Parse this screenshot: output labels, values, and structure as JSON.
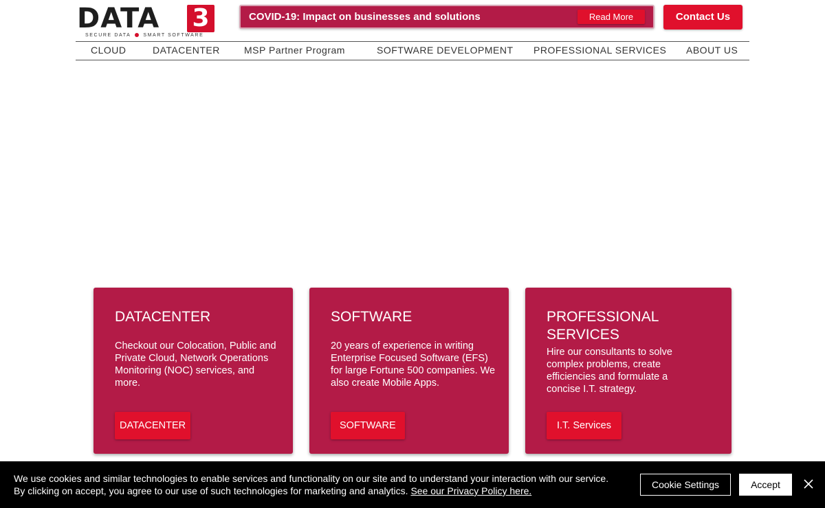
{
  "header": {
    "logo": {
      "word": "DATA",
      "digit": "3",
      "tagline_left": "SECURE DATA",
      "tagline_right": "SMART SOFTWARE"
    },
    "banner": {
      "text": "COVID-19: Impact on businesses and solutions",
      "read_more": "Read More"
    },
    "contact_label": "Contact Us"
  },
  "nav": {
    "items": [
      {
        "label": "CLOUD"
      },
      {
        "label": "DATACENTER"
      },
      {
        "label": "MSP Partner Program"
      },
      {
        "label": "SOFTWARE DEVELOPMENT"
      },
      {
        "label": "PROFESSIONAL SERVICES"
      },
      {
        "label": "ABOUT US"
      }
    ]
  },
  "cards": [
    {
      "title": "DATACENTER",
      "description": "Checkout our Colocation, Public and Private Cloud, Network Operations Monitoring (NOC) services, and more.",
      "button": "DATACENTER"
    },
    {
      "title": "SOFTWARE",
      "description": "20 years of experience in writing Enterprise Focused Software (EFS) for large Fortune 500 companies. We also create Mobile Apps.",
      "button": "SOFTWARE"
    },
    {
      "title": "PROFESSIONAL SERVICES",
      "description": "Hire our consultants to solve complex problems,  create efficiencies and formulate a concise I.T. strategy.",
      "button": "I.T. Services"
    }
  ],
  "cookie": {
    "line1": "We use cookies and similar technologies to enable services and functionality on our site and to understand your interaction with our service.",
    "line2": "By clicking on accept, you agree to our use of such technologies for marketing and analytics.",
    "privacy_link": "See our Privacy Policy here.",
    "settings_label": "Cookie Settings",
    "accept_label": "Accept"
  },
  "colors": {
    "brand_red": "#e0102c",
    "card_crimson": "#b31b47",
    "logo_dark": "#1e1e1e",
    "cookie_bg": "#000000"
  },
  "icons": {
    "cookie_close": "close-icon"
  }
}
